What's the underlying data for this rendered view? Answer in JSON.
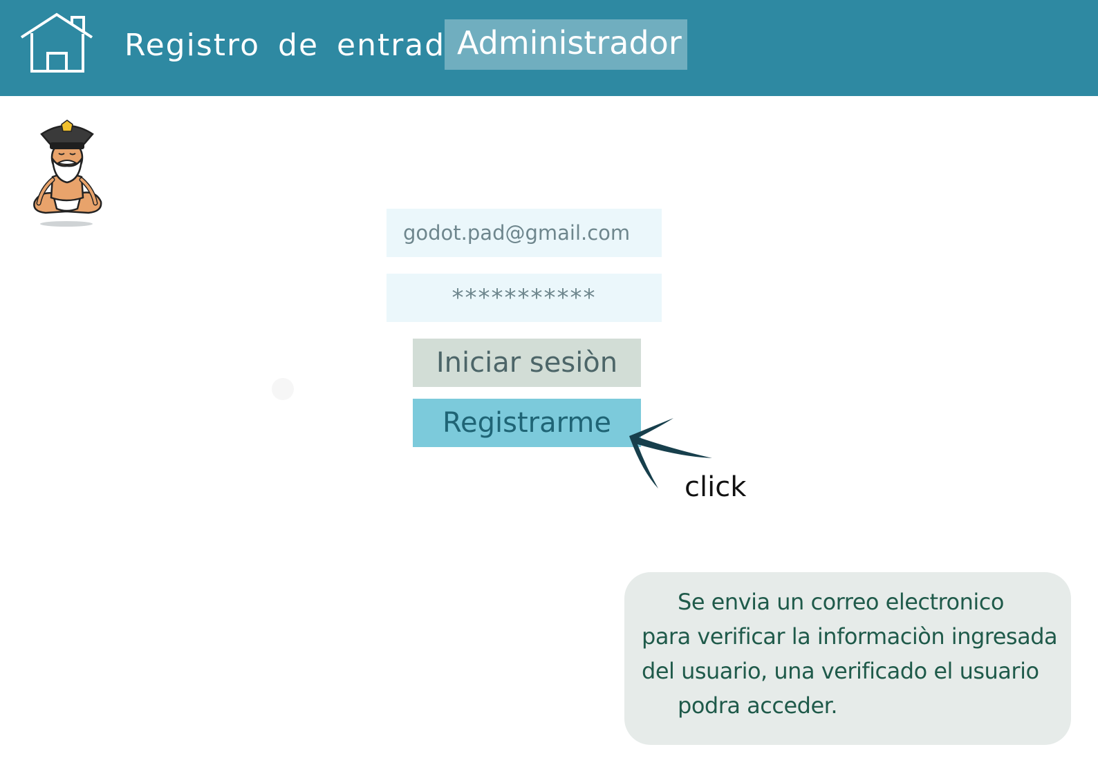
{
  "header": {
    "title": "Registro de entrada",
    "role_badge": "Administrador",
    "home_icon": "home-icon",
    "color": "#2e89a2"
  },
  "avatar": {
    "icon": "meditating-police-officer-avatar"
  },
  "login_form": {
    "email_value": "godot.pad@gmail.com",
    "password_value": "***********",
    "login_button": "Iniciar sesiòn",
    "register_button": "Registrarme"
  },
  "annotation": {
    "cursor_icon": "cursor-arrow-icon",
    "click_label": "click"
  },
  "note": {
    "lines": [
      "Se envia un correo electronico",
      "para verificar la informaciòn ingresada",
      "del usuario, una verificado el usuario",
      "podra acceder."
    ]
  },
  "colors": {
    "header_bg": "#2e89a2",
    "badge_bg": "#70aebf",
    "input_bg": "#ebf7fb",
    "login_button_bg": "#d2ddd6",
    "register_button_bg": "#7ccadb",
    "note_bg": "#e6ebe9"
  }
}
